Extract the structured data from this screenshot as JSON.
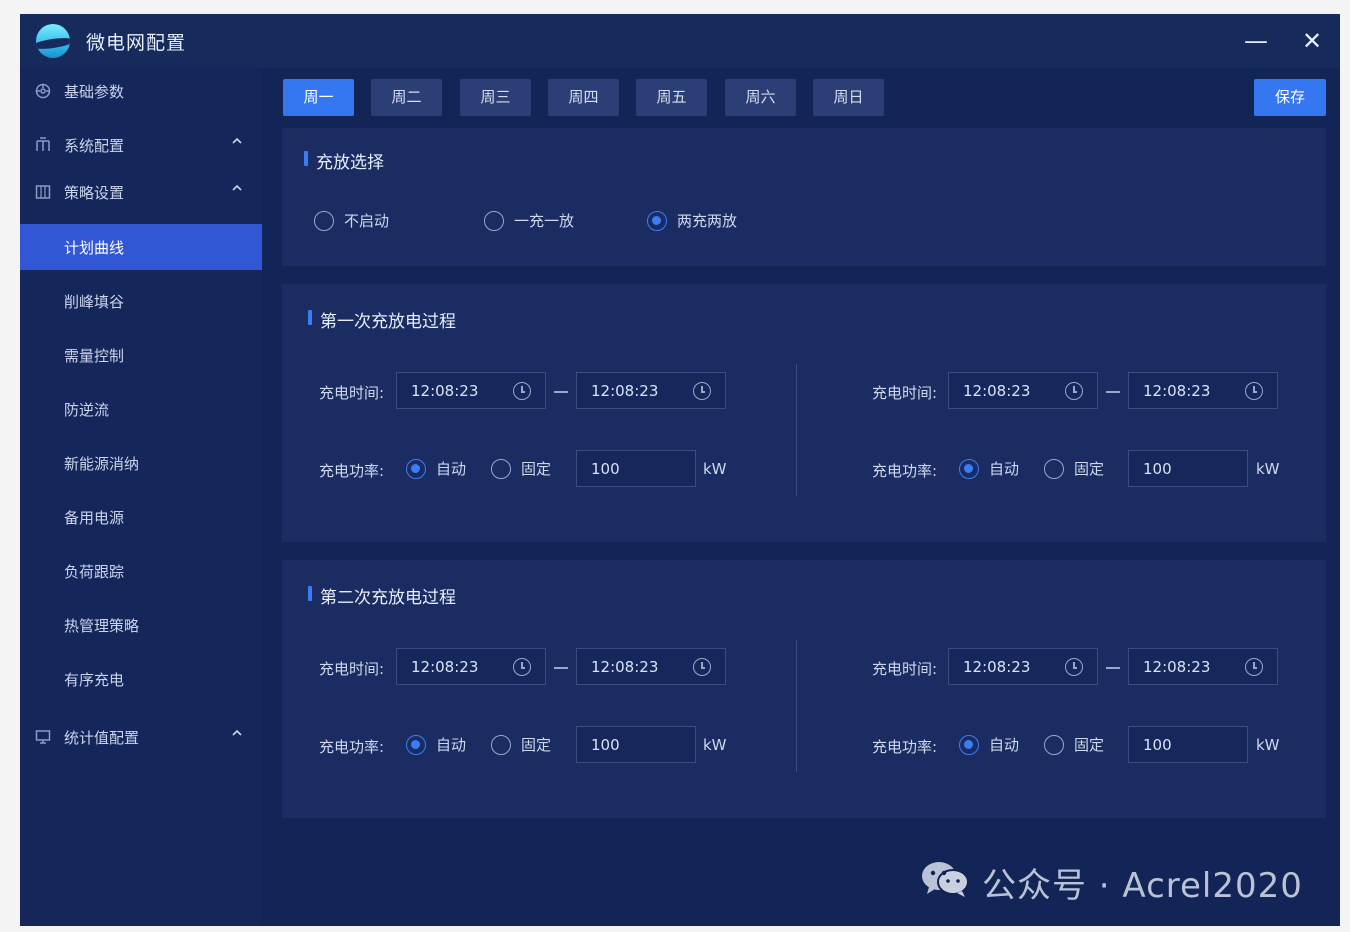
{
  "window": {
    "title": "微电网配置",
    "minimize_label": "—",
    "close_label": "✕"
  },
  "sidebar": {
    "items": [
      {
        "label": "基础参数",
        "icon": "gear-icon"
      },
      {
        "label": "系统配置",
        "icon": "network-icon",
        "expanded": true
      },
      {
        "label": "策略设置",
        "icon": "grid-icon",
        "expanded": true
      },
      {
        "label": "统计值配置",
        "icon": "monitor-icon",
        "expanded": true
      }
    ],
    "sub_items": [
      {
        "label": "计划曲线",
        "active": true
      },
      {
        "label": "削峰填谷"
      },
      {
        "label": "需量控制"
      },
      {
        "label": "防逆流"
      },
      {
        "label": "新能源消纳"
      },
      {
        "label": "备用电源"
      },
      {
        "label": "负荷跟踪"
      },
      {
        "label": "热管理策略"
      },
      {
        "label": "有序充电"
      }
    ]
  },
  "tabs": [
    {
      "label": "周一",
      "active": true
    },
    {
      "label": "周二"
    },
    {
      "label": "周三"
    },
    {
      "label": "周四"
    },
    {
      "label": "周五"
    },
    {
      "label": "周六"
    },
    {
      "label": "周日"
    }
  ],
  "save_label": "保存",
  "charge_mode": {
    "title": "充放选择",
    "options": [
      {
        "label": "不启动",
        "checked": false
      },
      {
        "label": "一充一放",
        "checked": false
      },
      {
        "label": "两充两放",
        "checked": true
      }
    ]
  },
  "process1": {
    "title": "第一次充放电过程",
    "left": {
      "time_label": "充电时间:",
      "start": "12:08:23",
      "end": "12:08:23",
      "power_label": "充电功率:",
      "auto_label": "自动",
      "fixed_label": "固定",
      "mode": "auto",
      "power_value": "100",
      "unit": "kW"
    },
    "right": {
      "time_label": "充电时间:",
      "start": "12:08:23",
      "end": "12:08:23",
      "power_label": "充电功率:",
      "auto_label": "自动",
      "fixed_label": "固定",
      "mode": "auto",
      "power_value": "100",
      "unit": "kW"
    }
  },
  "process2": {
    "title": "第二次充放电过程",
    "left": {
      "time_label": "充电时间:",
      "start": "12:08:23",
      "end": "12:08:23",
      "power_label": "充电功率:",
      "auto_label": "自动",
      "fixed_label": "固定",
      "mode": "auto",
      "power_value": "100",
      "unit": "kW"
    },
    "right": {
      "time_label": "充电时间:",
      "start": "12:08:23",
      "end": "12:08:23",
      "power_label": "充电功率:",
      "auto_label": "自动",
      "fixed_label": "固定",
      "mode": "auto",
      "power_value": "100",
      "unit": "kW"
    }
  },
  "watermark": {
    "text": "公众号 · Acrel2020",
    "icon": "wechat-icon"
  }
}
